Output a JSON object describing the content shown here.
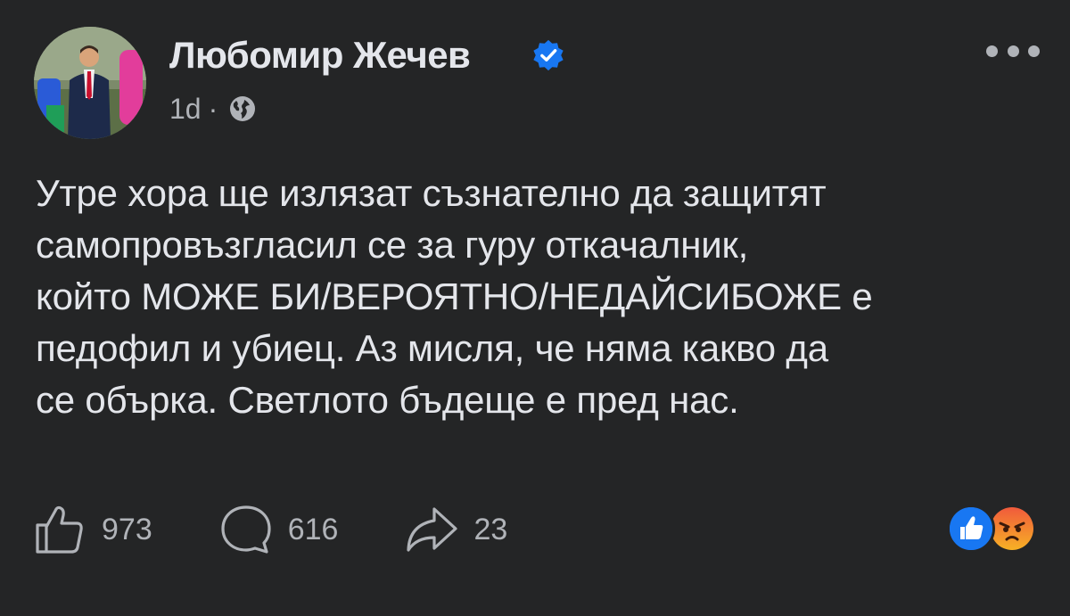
{
  "author": {
    "name": "Любомир Жечев",
    "verified": true
  },
  "meta": {
    "time": "1d",
    "separator": "·",
    "audience_icon": "globe-icon"
  },
  "post": {
    "lines": [
      "Утре хора ще излязат съзнателно да защитят",
      "самопровъзгласил се за гуру откачалник,",
      "който МОЖЕ БИ/ВЕРОЯТНО/НЕДАЙСИБОЖЕ е",
      "педофил и убиец. Аз мисля, че няма какво да",
      "се обърка. Светлото бъдеще е пред нас."
    ]
  },
  "actions": {
    "like_count": "973",
    "comment_count": "616",
    "share_count": "23"
  },
  "reactions": [
    "like",
    "angry"
  ],
  "colors": {
    "background": "#242526",
    "text": "#e4e6eb",
    "secondary_text": "#b0b3b8",
    "verified_blue": "#1877f2"
  }
}
